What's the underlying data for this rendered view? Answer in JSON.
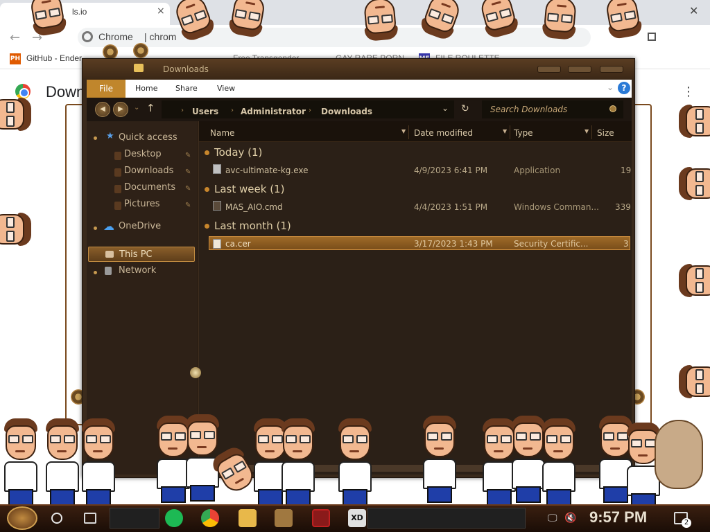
{
  "browser": {
    "tab_title": "ls.io",
    "tab_close": "×",
    "window_close": "✕",
    "back": "←",
    "forward": "→",
    "omnibox_label": "Chrome",
    "omnibox_url": "|  chrom",
    "menu_dots": "⋮",
    "bookmarks": [
      {
        "icon": "PH",
        "label": "GitHub - Ender"
      },
      {
        "icon": "",
        "label": "Free Transgender"
      },
      {
        "icon": "",
        "label": "GAY RARE PORN"
      },
      {
        "icon": "MF",
        "label": "FILE ROULETTE"
      }
    ],
    "page_title": "Downloads"
  },
  "explorer": {
    "title": "Downloads",
    "ribbon": {
      "file": "File",
      "home": "Home",
      "share": "Share",
      "view": "View",
      "help": "?",
      "chevron": "⌄"
    },
    "address": {
      "up": "↑",
      "crumbs": [
        "Users",
        "Administrator",
        "Downloads"
      ],
      "dropdown": "⌄",
      "refresh": "↻"
    },
    "search_placeholder": "Search Downloads",
    "nav": {
      "quick_access": "Quick access",
      "desktop": "Desktop",
      "downloads": "Downloads",
      "documents": "Documents",
      "pictures": "Pictures",
      "onedrive": "OneDrive",
      "this_pc": "This PC",
      "network": "Network"
    },
    "columns": {
      "name": "Name",
      "date": "Date modified",
      "type": "Type",
      "size": "Size"
    },
    "groups": [
      {
        "header": "Today (1)",
        "file": {
          "name": "avc-ultimate-kg.exe",
          "date": "4/9/2023 6:41 PM",
          "type": "Application",
          "size": "19"
        }
      },
      {
        "header": "Last week (1)",
        "file": {
          "name": "MAS_AIO.cmd",
          "date": "4/4/2023 1:51 PM",
          "type": "Windows Comman...",
          "size": "339"
        }
      },
      {
        "header": "Last month (1)",
        "file": {
          "name": "ca.cer",
          "date": "3/17/2023 1:43 PM",
          "type": "Security Certific...",
          "size": "3"
        }
      }
    ]
  },
  "taskbar": {
    "xd_label": "XD",
    "network_icon": "🖵",
    "volume_icon": "🔇",
    "clock": "9:57 PM",
    "notification_count": "2"
  },
  "colors": {
    "accent": "#c0862c",
    "selection": "#9e6a28",
    "explorer_bg": "#2b2017"
  }
}
